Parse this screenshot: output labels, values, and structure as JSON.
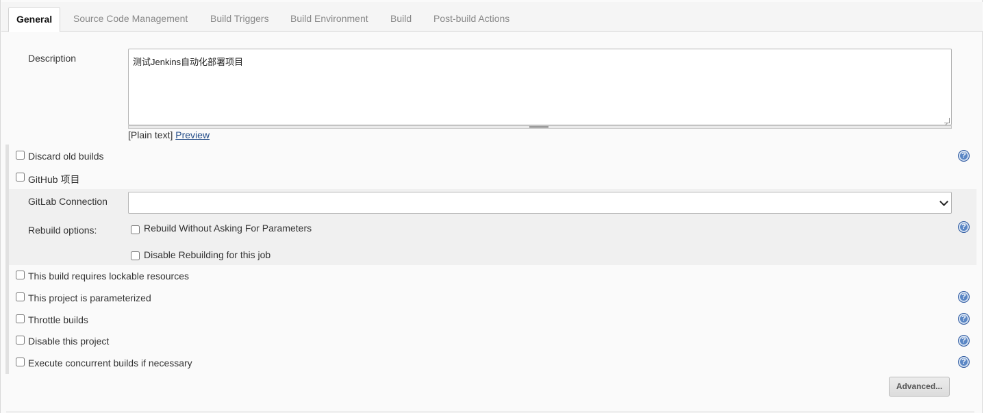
{
  "tabs": [
    {
      "label": "General",
      "active": true
    },
    {
      "label": "Source Code Management",
      "active": false
    },
    {
      "label": "Build Triggers",
      "active": false
    },
    {
      "label": "Build Environment",
      "active": false
    },
    {
      "label": "Build",
      "active": false
    },
    {
      "label": "Post-build Actions",
      "active": false
    }
  ],
  "description": {
    "label": "Description",
    "value": "测试Jenkins自动化部署项目",
    "format_text": "[Plain text]",
    "preview_link": "Preview"
  },
  "options": {
    "discard_old_builds": "Discard old builds",
    "github_project": "GitHub 项目",
    "gitlab_connection_label": "GitLab Connection",
    "gitlab_connection_value": "",
    "rebuild_options_label": "Rebuild options:",
    "rebuild_without_asking": "Rebuild Without Asking For Parameters",
    "disable_rebuilding": "Disable Rebuilding for this job",
    "lockable_resources": "This build requires lockable resources",
    "parameterized": "This project is parameterized",
    "throttle_builds": "Throttle builds",
    "disable_project": "Disable this project",
    "concurrent_builds": "Execute concurrent builds if necessary"
  },
  "advanced_button": "Advanced...",
  "colors": {
    "help_icon": "#5b87c5",
    "link": "#204a87",
    "active_tab_text": "#111111",
    "inactive_tab_text": "#888888"
  }
}
